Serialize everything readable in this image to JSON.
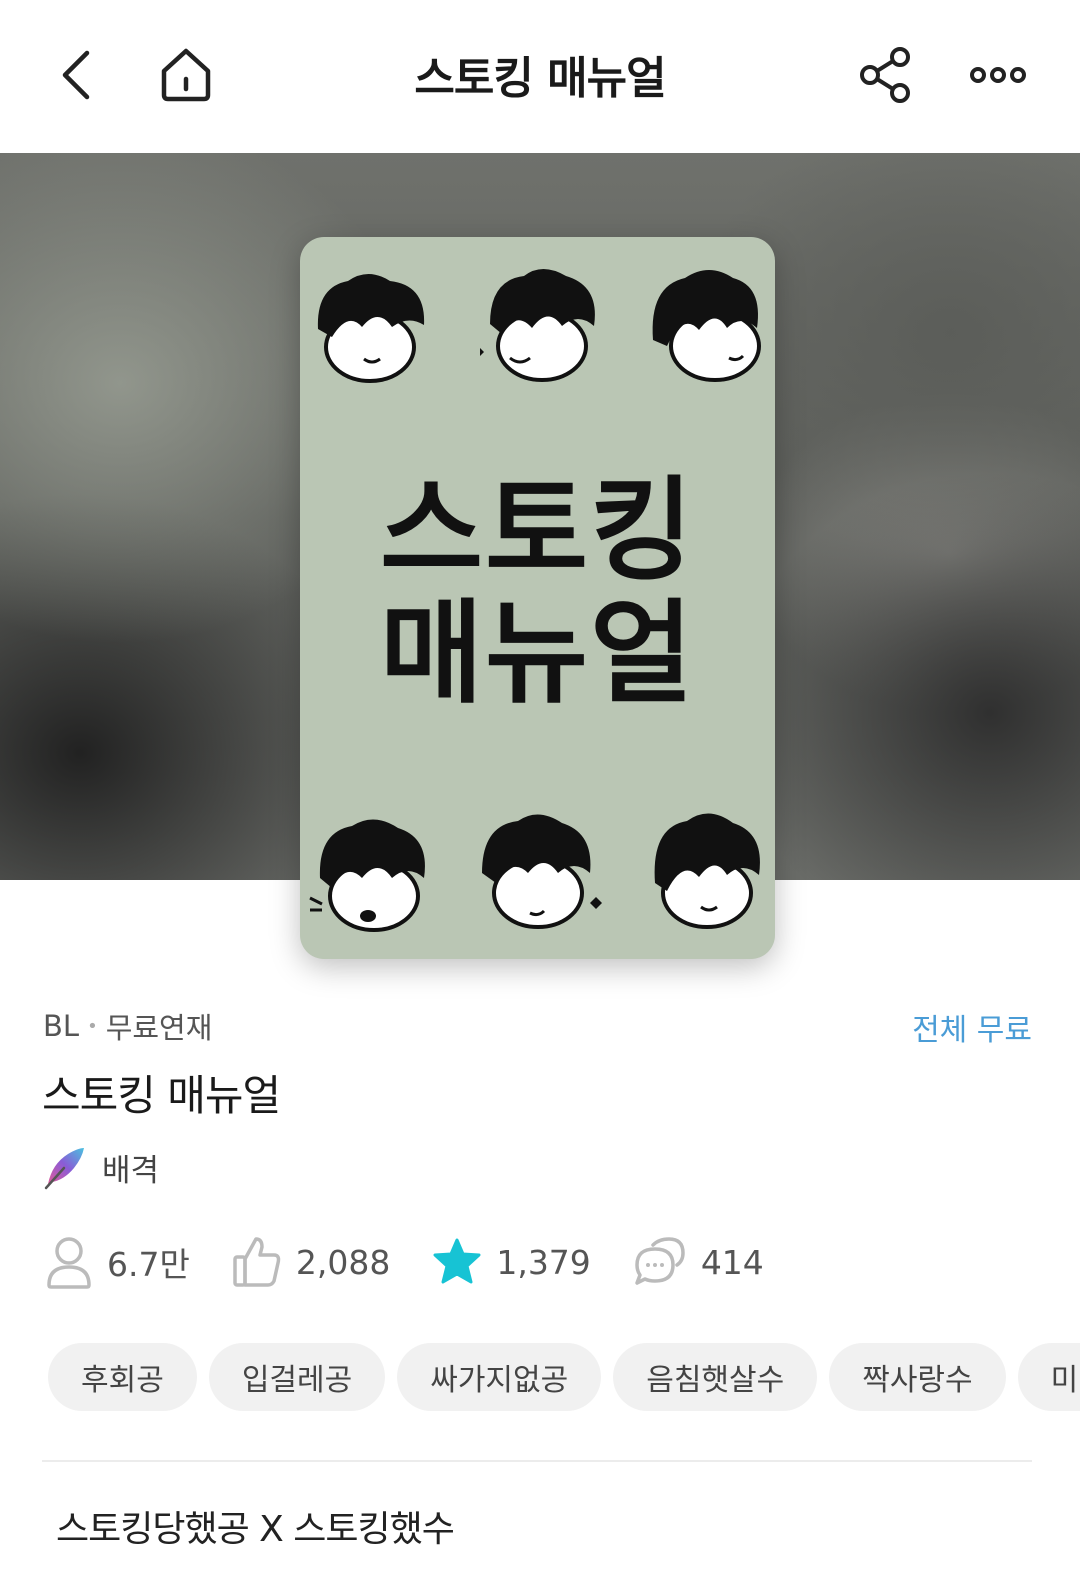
{
  "header": {
    "title": "스토킹 매뉴얼",
    "back_icon": "chevron-left-icon",
    "home_icon": "home-icon",
    "share_icon": "share-icon",
    "more_icon": "more-icon"
  },
  "cover": {
    "title_line1": "스토킹",
    "title_line2": "매뉴얼",
    "bg_color": "#bac6b4"
  },
  "info": {
    "genre": "BL",
    "serial_type": "무료연재",
    "price_badge": "전체 무료",
    "title": "스토킹 매뉴얼",
    "author": "배격"
  },
  "stats": {
    "views": "6.7만",
    "likes": "2,088",
    "favorites": "1,379",
    "comments": "414"
  },
  "tags": [
    "후회공",
    "입걸레공",
    "싸가지없공",
    "음침햇살수",
    "짝사랑수",
    "미인"
  ],
  "summary": "스토킹당했공 X 스토킹했수",
  "colors": {
    "accent_blue": "#4a9cd6",
    "star_cyan": "#17c3d4",
    "tag_bg": "#f1f1f1"
  }
}
